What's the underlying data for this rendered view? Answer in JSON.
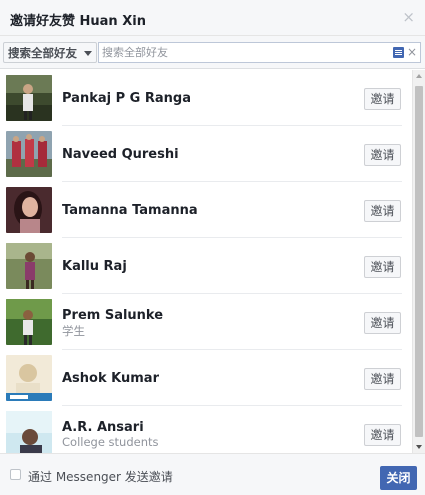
{
  "dialog": {
    "title": "邀请好友赞 Huan Xin",
    "close_glyph": "×"
  },
  "search": {
    "filter_label": "搜索全部好友",
    "value": "",
    "placeholder": "搜索全部好友",
    "clear_glyph": "×"
  },
  "friends": [
    {
      "name": "Pankaj P G Ranga",
      "subtitle": "",
      "invite_label": "邀请"
    },
    {
      "name": "Naveed Qureshi",
      "subtitle": "",
      "invite_label": "邀请"
    },
    {
      "name": "Tamanna Tamanna",
      "subtitle": "",
      "invite_label": "邀请"
    },
    {
      "name": "Kallu Raj",
      "subtitle": "",
      "invite_label": "邀请"
    },
    {
      "name": "Prem Salunke",
      "subtitle": "学生",
      "invite_label": "邀请"
    },
    {
      "name": "Ashok Kumar",
      "subtitle": "",
      "invite_label": "邀请"
    },
    {
      "name": "A.R. Ansari",
      "subtitle": "College students",
      "invite_label": "邀请"
    }
  ],
  "footer": {
    "messenger_label": "通过 Messenger 发送邀请",
    "messenger_checked": false,
    "close_label": "关闭"
  },
  "colors": {
    "brand_blue": "#4267b2",
    "secondary_text": "#90949c"
  }
}
